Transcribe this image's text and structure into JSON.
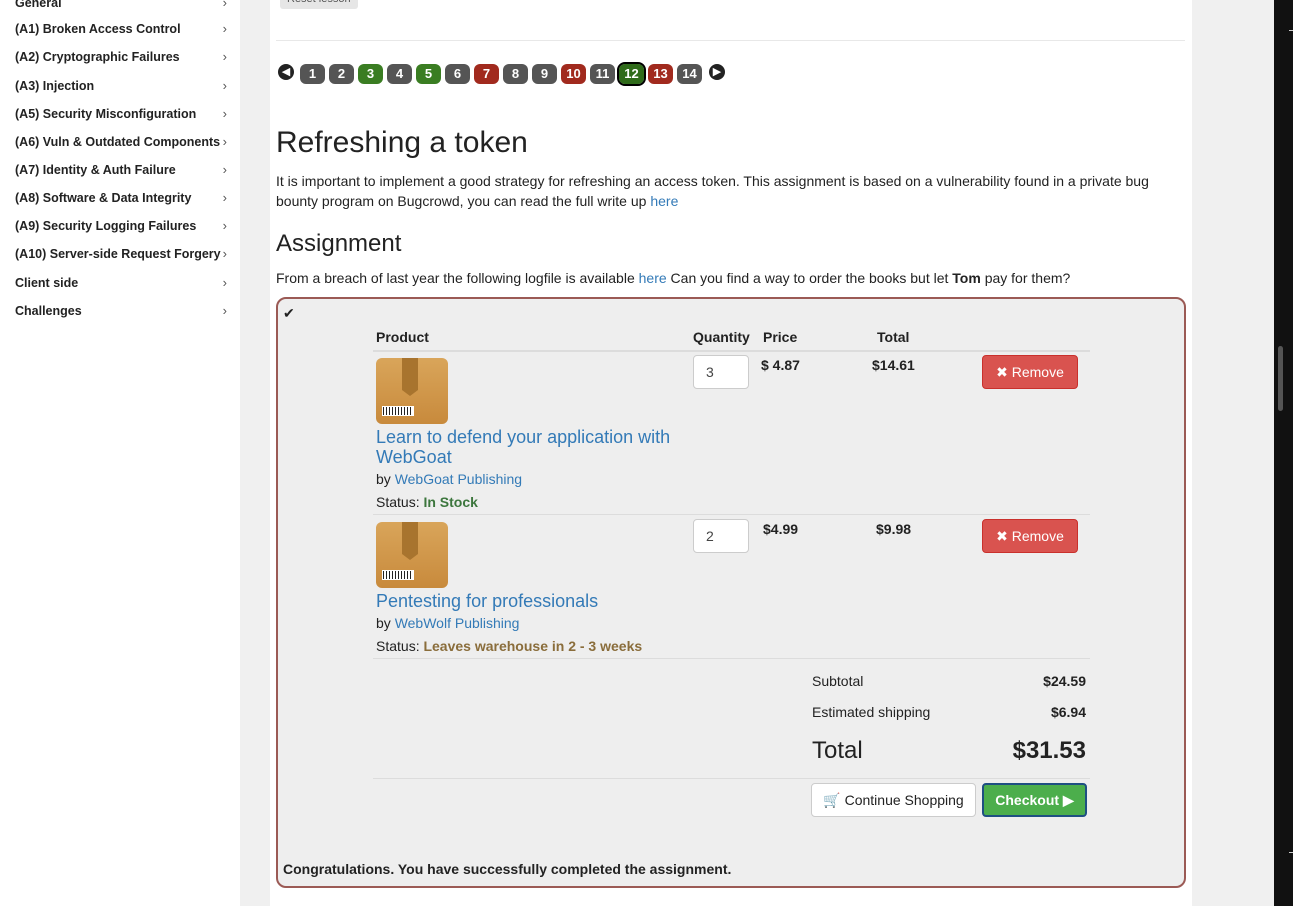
{
  "sidebar": {
    "items": [
      {
        "label": "General"
      },
      {
        "label": "(A1) Broken Access Control"
      },
      {
        "label": "(A2) Cryptographic Failures"
      },
      {
        "label": "(A3) Injection"
      },
      {
        "label": "(A5) Security Misconfiguration"
      },
      {
        "label": "(A6) Vuln & Outdated Components"
      },
      {
        "label": "(A7) Identity & Auth Failure"
      },
      {
        "label": "(A8) Software & Data Integrity"
      },
      {
        "label": "(A9) Security Logging Failures"
      },
      {
        "label": "(A10) Server-side Request Forgery"
      },
      {
        "label": "Client side"
      },
      {
        "label": "Challenges"
      }
    ],
    "chevron": "›"
  },
  "lesson": {
    "reset_label": "Reset lesson",
    "pages": [
      {
        "n": "1",
        "state": "gray"
      },
      {
        "n": "2",
        "state": "gray"
      },
      {
        "n": "3",
        "state": "green"
      },
      {
        "n": "4",
        "state": "gray"
      },
      {
        "n": "5",
        "state": "green"
      },
      {
        "n": "6",
        "state": "gray"
      },
      {
        "n": "7",
        "state": "red"
      },
      {
        "n": "8",
        "state": "gray"
      },
      {
        "n": "9",
        "state": "gray"
      },
      {
        "n": "10",
        "state": "red"
      },
      {
        "n": "11",
        "state": "gray"
      },
      {
        "n": "12",
        "state": "active"
      },
      {
        "n": "13",
        "state": "red"
      },
      {
        "n": "14",
        "state": "gray"
      }
    ],
    "title": "Refreshing a token",
    "intro_1": "It is important to implement a good strategy for refreshing an access token. This assignment is based on a vulnerability found in a private bug bounty program on Bugcrowd, you can read the full write up ",
    "intro_link": "here",
    "assignment_heading": "Assignment",
    "assign_1": "From a breach of last year the following logfile is available ",
    "assign_link": "here",
    "assign_2": " Can you find a way to order the books but let ",
    "assign_bold": "Tom",
    "assign_3": " pay for them?"
  },
  "cart": {
    "headers": {
      "product": "Product",
      "quantity": "Quantity",
      "price": "Price",
      "total": "Total"
    },
    "items": [
      {
        "title": "Learn to defend your application with WebGoat",
        "by": "by ",
        "publisher": "WebGoat Publishing",
        "status_label": "Status: ",
        "status": "In Stock",
        "status_color": "#3c763d",
        "qty": "3",
        "price": "$ 4.87",
        "total": "$14.61",
        "remove": "Remove"
      },
      {
        "title": "Pentesting for professionals",
        "by": "by ",
        "publisher": "WebWolf Publishing",
        "status_label": "Status: ",
        "status": "Leaves warehouse in 2 - 3 weeks",
        "status_color": "#8a6d3b",
        "qty": "2",
        "price": "$4.99",
        "total": "$9.98",
        "remove": "Remove"
      }
    ],
    "subtotal_label": "Subtotal",
    "subtotal": "$24.59",
    "shipping_label": "Estimated shipping",
    "shipping": "$6.94",
    "total_label": "Total",
    "total": "$31.53",
    "continue_label": "Continue Shopping",
    "checkout_label": "Checkout",
    "remove_icon": "✖",
    "cart_icon": "🛒",
    "play_icon": "▶"
  },
  "feedback": "Congratulations. You have successfully completed the assignment.",
  "check_icon": "✔"
}
